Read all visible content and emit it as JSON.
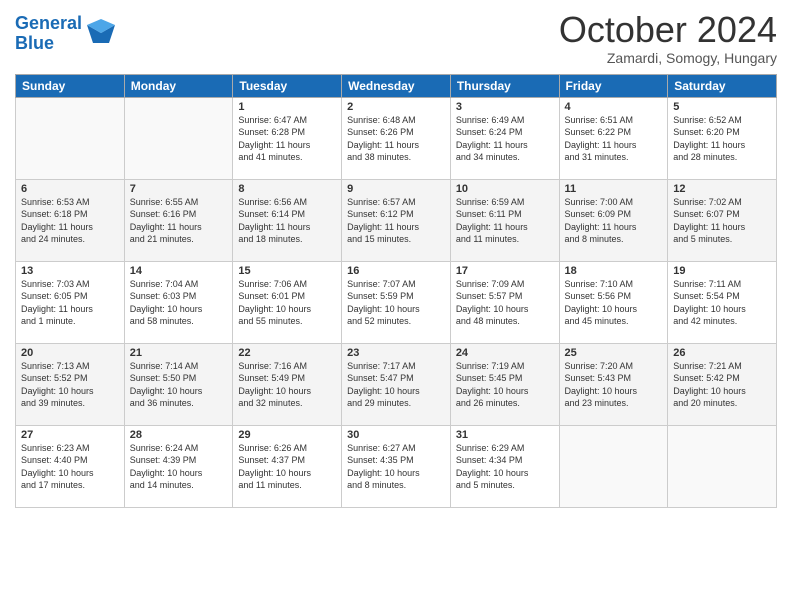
{
  "header": {
    "logo_line1": "General",
    "logo_line2": "Blue",
    "month": "October 2024",
    "location": "Zamardi, Somogy, Hungary"
  },
  "weekdays": [
    "Sunday",
    "Monday",
    "Tuesday",
    "Wednesday",
    "Thursday",
    "Friday",
    "Saturday"
  ],
  "rows": [
    [
      {
        "day": "",
        "info": ""
      },
      {
        "day": "",
        "info": ""
      },
      {
        "day": "1",
        "info": "Sunrise: 6:47 AM\nSunset: 6:28 PM\nDaylight: 11 hours\nand 41 minutes."
      },
      {
        "day": "2",
        "info": "Sunrise: 6:48 AM\nSunset: 6:26 PM\nDaylight: 11 hours\nand 38 minutes."
      },
      {
        "day": "3",
        "info": "Sunrise: 6:49 AM\nSunset: 6:24 PM\nDaylight: 11 hours\nand 34 minutes."
      },
      {
        "day": "4",
        "info": "Sunrise: 6:51 AM\nSunset: 6:22 PM\nDaylight: 11 hours\nand 31 minutes."
      },
      {
        "day": "5",
        "info": "Sunrise: 6:52 AM\nSunset: 6:20 PM\nDaylight: 11 hours\nand 28 minutes."
      }
    ],
    [
      {
        "day": "6",
        "info": "Sunrise: 6:53 AM\nSunset: 6:18 PM\nDaylight: 11 hours\nand 24 minutes."
      },
      {
        "day": "7",
        "info": "Sunrise: 6:55 AM\nSunset: 6:16 PM\nDaylight: 11 hours\nand 21 minutes."
      },
      {
        "day": "8",
        "info": "Sunrise: 6:56 AM\nSunset: 6:14 PM\nDaylight: 11 hours\nand 18 minutes."
      },
      {
        "day": "9",
        "info": "Sunrise: 6:57 AM\nSunset: 6:12 PM\nDaylight: 11 hours\nand 15 minutes."
      },
      {
        "day": "10",
        "info": "Sunrise: 6:59 AM\nSunset: 6:11 PM\nDaylight: 11 hours\nand 11 minutes."
      },
      {
        "day": "11",
        "info": "Sunrise: 7:00 AM\nSunset: 6:09 PM\nDaylight: 11 hours\nand 8 minutes."
      },
      {
        "day": "12",
        "info": "Sunrise: 7:02 AM\nSunset: 6:07 PM\nDaylight: 11 hours\nand 5 minutes."
      }
    ],
    [
      {
        "day": "13",
        "info": "Sunrise: 7:03 AM\nSunset: 6:05 PM\nDaylight: 11 hours\nand 1 minute."
      },
      {
        "day": "14",
        "info": "Sunrise: 7:04 AM\nSunset: 6:03 PM\nDaylight: 10 hours\nand 58 minutes."
      },
      {
        "day": "15",
        "info": "Sunrise: 7:06 AM\nSunset: 6:01 PM\nDaylight: 10 hours\nand 55 minutes."
      },
      {
        "day": "16",
        "info": "Sunrise: 7:07 AM\nSunset: 5:59 PM\nDaylight: 10 hours\nand 52 minutes."
      },
      {
        "day": "17",
        "info": "Sunrise: 7:09 AM\nSunset: 5:57 PM\nDaylight: 10 hours\nand 48 minutes."
      },
      {
        "day": "18",
        "info": "Sunrise: 7:10 AM\nSunset: 5:56 PM\nDaylight: 10 hours\nand 45 minutes."
      },
      {
        "day": "19",
        "info": "Sunrise: 7:11 AM\nSunset: 5:54 PM\nDaylight: 10 hours\nand 42 minutes."
      }
    ],
    [
      {
        "day": "20",
        "info": "Sunrise: 7:13 AM\nSunset: 5:52 PM\nDaylight: 10 hours\nand 39 minutes."
      },
      {
        "day": "21",
        "info": "Sunrise: 7:14 AM\nSunset: 5:50 PM\nDaylight: 10 hours\nand 36 minutes."
      },
      {
        "day": "22",
        "info": "Sunrise: 7:16 AM\nSunset: 5:49 PM\nDaylight: 10 hours\nand 32 minutes."
      },
      {
        "day": "23",
        "info": "Sunrise: 7:17 AM\nSunset: 5:47 PM\nDaylight: 10 hours\nand 29 minutes."
      },
      {
        "day": "24",
        "info": "Sunrise: 7:19 AM\nSunset: 5:45 PM\nDaylight: 10 hours\nand 26 minutes."
      },
      {
        "day": "25",
        "info": "Sunrise: 7:20 AM\nSunset: 5:43 PM\nDaylight: 10 hours\nand 23 minutes."
      },
      {
        "day": "26",
        "info": "Sunrise: 7:21 AM\nSunset: 5:42 PM\nDaylight: 10 hours\nand 20 minutes."
      }
    ],
    [
      {
        "day": "27",
        "info": "Sunrise: 6:23 AM\nSunset: 4:40 PM\nDaylight: 10 hours\nand 17 minutes."
      },
      {
        "day": "28",
        "info": "Sunrise: 6:24 AM\nSunset: 4:39 PM\nDaylight: 10 hours\nand 14 minutes."
      },
      {
        "day": "29",
        "info": "Sunrise: 6:26 AM\nSunset: 4:37 PM\nDaylight: 10 hours\nand 11 minutes."
      },
      {
        "day": "30",
        "info": "Sunrise: 6:27 AM\nSunset: 4:35 PM\nDaylight: 10 hours\nand 8 minutes."
      },
      {
        "day": "31",
        "info": "Sunrise: 6:29 AM\nSunset: 4:34 PM\nDaylight: 10 hours\nand 5 minutes."
      },
      {
        "day": "",
        "info": ""
      },
      {
        "day": "",
        "info": ""
      }
    ]
  ]
}
